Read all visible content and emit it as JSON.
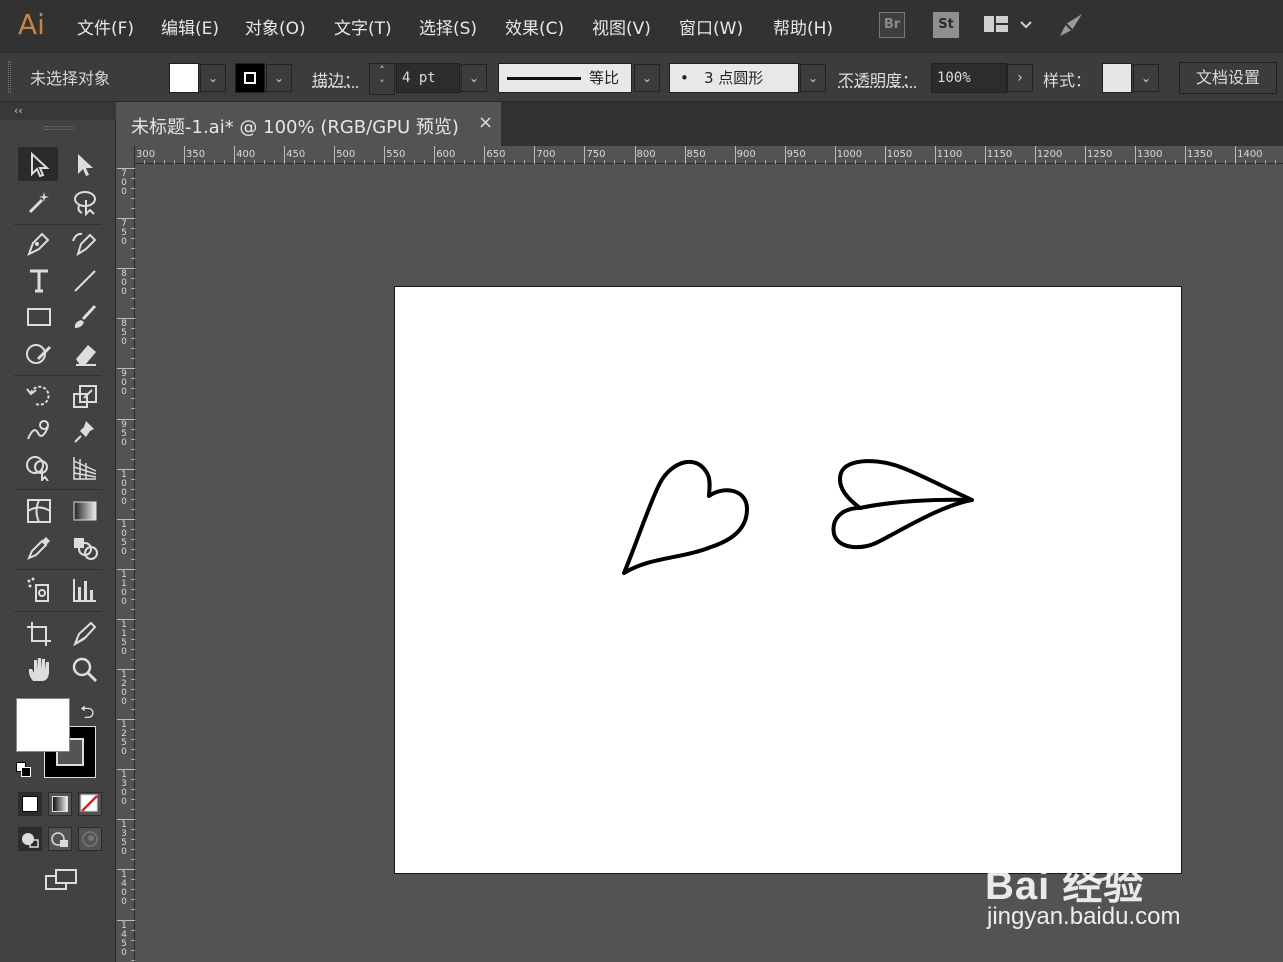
{
  "app": {
    "logo": "Ai"
  },
  "menu": {
    "items": [
      "文件(F)",
      "编辑(E)",
      "对象(O)",
      "文字(T)",
      "选择(S)",
      "效果(C)",
      "视图(V)",
      "窗口(W)",
      "帮助(H)"
    ],
    "bridge_label": "Br",
    "stock_label": "St"
  },
  "control_bar": {
    "selection_status": "未选择对象",
    "fill_color": "#ffffff",
    "stroke_color": "#000000",
    "stroke_label": "描边：",
    "stroke_weight": "4 pt",
    "profile_label": "等比",
    "brush_dot": "•",
    "brush_label": "3 点圆形",
    "opacity_label": "不透明度：",
    "opacity_value": "100%",
    "style_label": "样式：",
    "doc_setup_label": "文档设置"
  },
  "toolbar": {
    "collapse_label": "‹‹"
  },
  "document": {
    "tab_title": "未标题-1.ai* @ 100% (RGB/GPU 预览)",
    "close_glyph": "×"
  },
  "rulers": {
    "horizontal": [
      "300",
      "350",
      "400",
      "450",
      "500",
      "550",
      "600",
      "650",
      "700",
      "750",
      "800",
      "850",
      "900",
      "950",
      "1000",
      "1050",
      "1100",
      "1150",
      "1200",
      "1250",
      "1300",
      "1350",
      "1400"
    ],
    "vertical": [
      "700",
      "750",
      "800",
      "850",
      "900",
      "950",
      "1000",
      "1050",
      "1100",
      "1150",
      "1200",
      "1250",
      "1300",
      "1350",
      "1400",
      "1450"
    ]
  },
  "watermark": {
    "brand": "Bai 经验",
    "url": "jingyan.baidu.com"
  },
  "colors": {
    "accent": "#c98443",
    "panel": "#424242",
    "canvas": "#535353",
    "artboard": "#ffffff"
  }
}
